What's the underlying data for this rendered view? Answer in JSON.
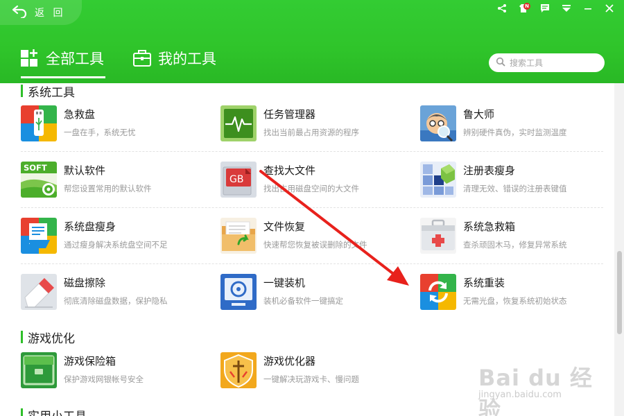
{
  "header": {
    "back_label": "返 回",
    "notification_badge": "N",
    "tabs": [
      {
        "label": "全部工具"
      },
      {
        "label": "我的工具"
      }
    ],
    "search_placeholder": "搜索工具"
  },
  "sections": [
    {
      "title": "系统工具",
      "items": [
        {
          "name": "急救盘",
          "desc": "一盘在手，系统无忧"
        },
        {
          "name": "任务管理器",
          "desc": "找出当前最占用资源的程序"
        },
        {
          "name": "鲁大师",
          "desc": "辨别硬件真伪，实时监测温度"
        },
        {
          "name": "默认软件",
          "desc": "帮您设置常用的默认软件",
          "icon_text": "SOFT"
        },
        {
          "name": "查找大文件",
          "desc": "找出占用磁盘空间的大文件",
          "icon_text": "GB"
        },
        {
          "name": "注册表瘦身",
          "desc": "清理无效、错误的注册表键值"
        },
        {
          "name": "系统盘瘦身",
          "desc": "通过瘦身解决系统盘空间不足"
        },
        {
          "name": "文件恢复",
          "desc": "快速帮您恢复被误删除的文件"
        },
        {
          "name": "系统急救箱",
          "desc": "查杀顽固木马，修复异常系统"
        },
        {
          "name": "磁盘擦除",
          "desc": "彻底清除磁盘数据，保护隐私"
        },
        {
          "name": "一键装机",
          "desc": "装机必备软件一键搞定"
        },
        {
          "name": "系统重装",
          "desc": "无需光盘，恢复系统初始状态"
        }
      ]
    },
    {
      "title": "游戏优化",
      "items": [
        {
          "name": "游戏保险箱",
          "desc": "保护游戏网银帐号安全"
        },
        {
          "name": "游戏优化器",
          "desc": "一键解决玩游戏卡、慢问题"
        }
      ]
    },
    {
      "title": "实用小工具",
      "items": []
    }
  ],
  "watermark": {
    "text": "Bai du 经验",
    "sub": "jingyan.baidu.com"
  },
  "colors": {
    "header_green": "#2fc42a",
    "accent_green": "#2fbf2a",
    "arrow_red": "#e8211c"
  }
}
